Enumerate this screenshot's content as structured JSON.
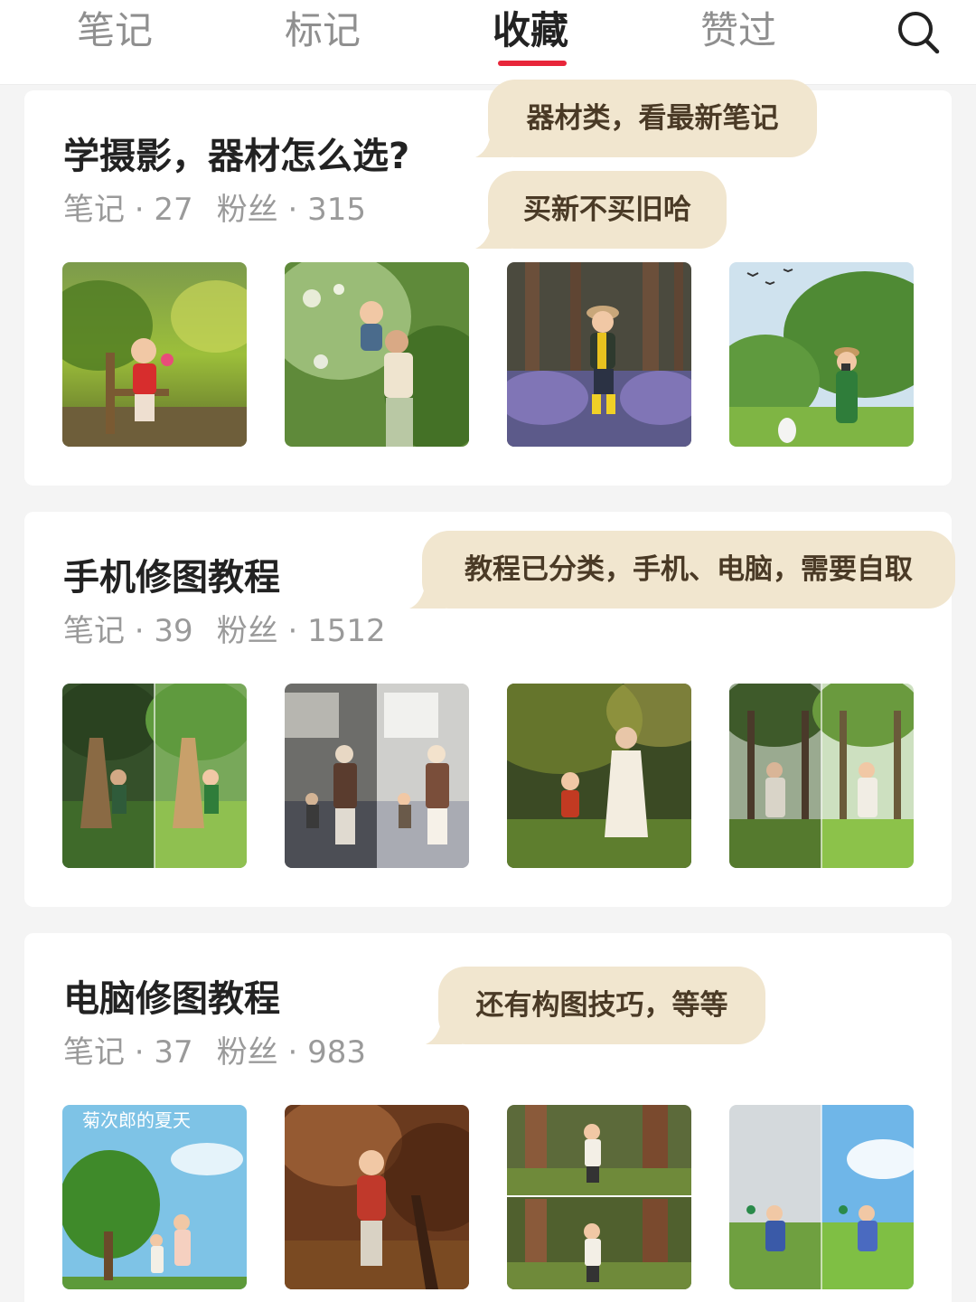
{
  "tabs": [
    {
      "label": "笔记",
      "active": false
    },
    {
      "label": "标记",
      "active": false
    },
    {
      "label": "收藏",
      "active": true
    },
    {
      "label": "赞过",
      "active": false
    }
  ],
  "accent_color": "#e8263a",
  "bubble_color": "#f1e6cf",
  "boards": [
    {
      "title": "学摄影，器材怎么选?",
      "notes_label": "笔记 · 27",
      "fans_label": "粉丝 · 315",
      "thumbnails": [
        "child-on-chair-in-garden",
        "mother-lifting-baby",
        "child-in-flower-field",
        "child-with-camera-on-lawn"
      ]
    },
    {
      "title": "手机修图教程",
      "notes_label": "笔记 · 39",
      "fans_label": "粉丝 · 1512",
      "thumbnails": [
        "before-after-easel-children",
        "before-after-street-family",
        "mother-and-child-on-grass",
        "before-after-forest-mother"
      ]
    },
    {
      "title": "电脑修图教程",
      "notes_label": "笔记 · 37",
      "fans_label": "粉丝 · 983",
      "thumbnails": [
        "summer-poster-tree",
        "child-in-autumn-leaves",
        "child-in-forest-collage",
        "before-after-sky-meadow"
      ]
    }
  ],
  "annotations": [
    "器材类，看最新笔记",
    "买新不买旧哈",
    "教程已分类，手机、电脑，需要自取",
    "还有构图技巧，等等"
  ],
  "thumb_overlay_text": "菊次郎的夏天"
}
